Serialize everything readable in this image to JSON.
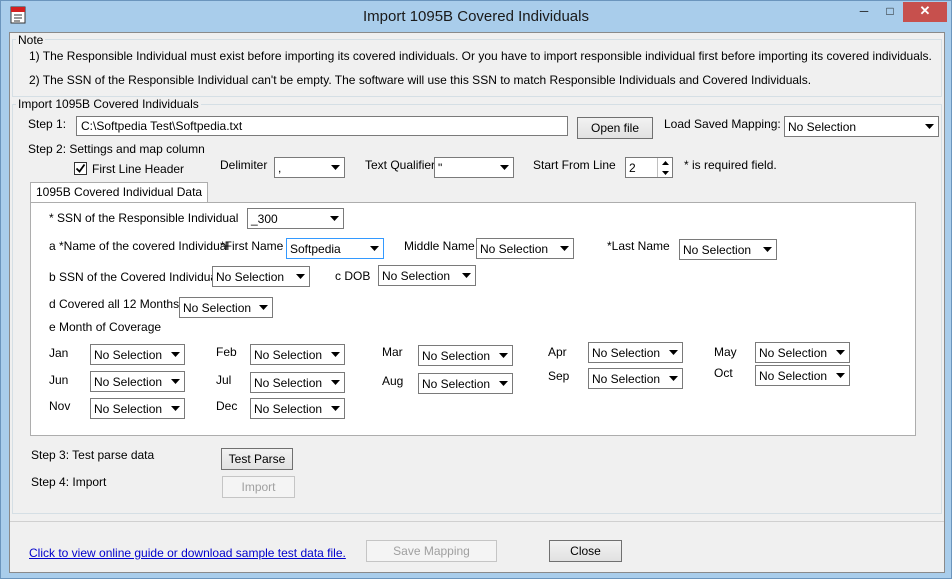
{
  "window": {
    "title": "Import 1095B Covered Individuals",
    "minimize": "─",
    "maximize": "□",
    "close": "✕"
  },
  "note": {
    "label": "Note",
    "line1": "1) The Responsible Individual must exist before importing its covered individuals. Or you have to import responsible individual first before importing its covered individuals.",
    "line2": "2) The SSN of the Responsible Individual can't be empty. The software will use this SSN to match Responsible Individuals and Covered Individuals."
  },
  "import_group": {
    "label": "Import 1095B Covered Individuals"
  },
  "step1": {
    "label": "Step 1:",
    "file_path": "C:\\Softpedia Test\\Softpedia.txt",
    "open_file": "Open file",
    "load_mapping_label": "Load Saved Mapping:",
    "load_mapping_value": "No Selection"
  },
  "step2": {
    "label": "Step 2:  Settings and map column",
    "first_line_header": "First Line Header",
    "first_line_header_checked": true,
    "delimiter_label": "Delimiter",
    "delimiter_value": ",",
    "text_qualifier_label": "Text Qualifier",
    "text_qualifier_value": "\"",
    "start_line_label": "Start From Line",
    "start_line_value": "2",
    "required_note": "* is required field."
  },
  "tab": {
    "label": "1095B Covered Individual Data"
  },
  "mapping": {
    "ssn_resp_label": "* SSN of the Responsible Individual",
    "ssn_resp_value": "_300",
    "name_label": "a *Name of the covered Individual",
    "first_name_label": "*First Name",
    "first_name_value": "Softpedia",
    "middle_name_label": "Middle Name",
    "middle_name_value": "No Selection",
    "last_name_label": "*Last Name",
    "last_name_value": "No Selection",
    "ssn_covered_label": "b SSN of the Covered Individual",
    "ssn_covered_value": "No Selection",
    "dob_label": "c DOB",
    "dob_value": "No Selection",
    "covered_all_label": "d Covered all 12 Months",
    "covered_all_value": "No Selection",
    "month_coverage_label": "e Month of Coverage"
  },
  "months": {
    "jan": {
      "label": "Jan",
      "value": "No Selection"
    },
    "feb": {
      "label": "Feb",
      "value": "No Selection"
    },
    "mar": {
      "label": "Mar",
      "value": "No Selection"
    },
    "apr": {
      "label": "Apr",
      "value": "No Selection"
    },
    "may": {
      "label": "May",
      "value": "No Selection"
    },
    "jun": {
      "label": "Jun",
      "value": "No Selection"
    },
    "jul": {
      "label": "Jul",
      "value": "No Selection"
    },
    "aug": {
      "label": "Aug",
      "value": "No Selection"
    },
    "sep": {
      "label": "Sep",
      "value": "No Selection"
    },
    "oct": {
      "label": "Oct",
      "value": "No Selection"
    },
    "nov": {
      "label": "Nov",
      "value": "No Selection"
    },
    "dec": {
      "label": "Dec",
      "value": "No Selection"
    }
  },
  "step3": {
    "label": "Step 3: Test parse data",
    "button": "Test Parse"
  },
  "step4": {
    "label": "Step 4: Import",
    "button": "Import"
  },
  "footer": {
    "link": "Click to view online guide or download sample test data file.",
    "save_mapping": "Save Mapping",
    "close": "Close"
  },
  "colors": {
    "title_bg": "#a9cdeb",
    "close_btn": "#c7504d",
    "link": "#0000cc",
    "focus_border": "#3399ff"
  },
  "icons": {
    "app": "app-document-icon",
    "dropdown": "chevron-down-icon",
    "check": "checkmark-icon"
  }
}
